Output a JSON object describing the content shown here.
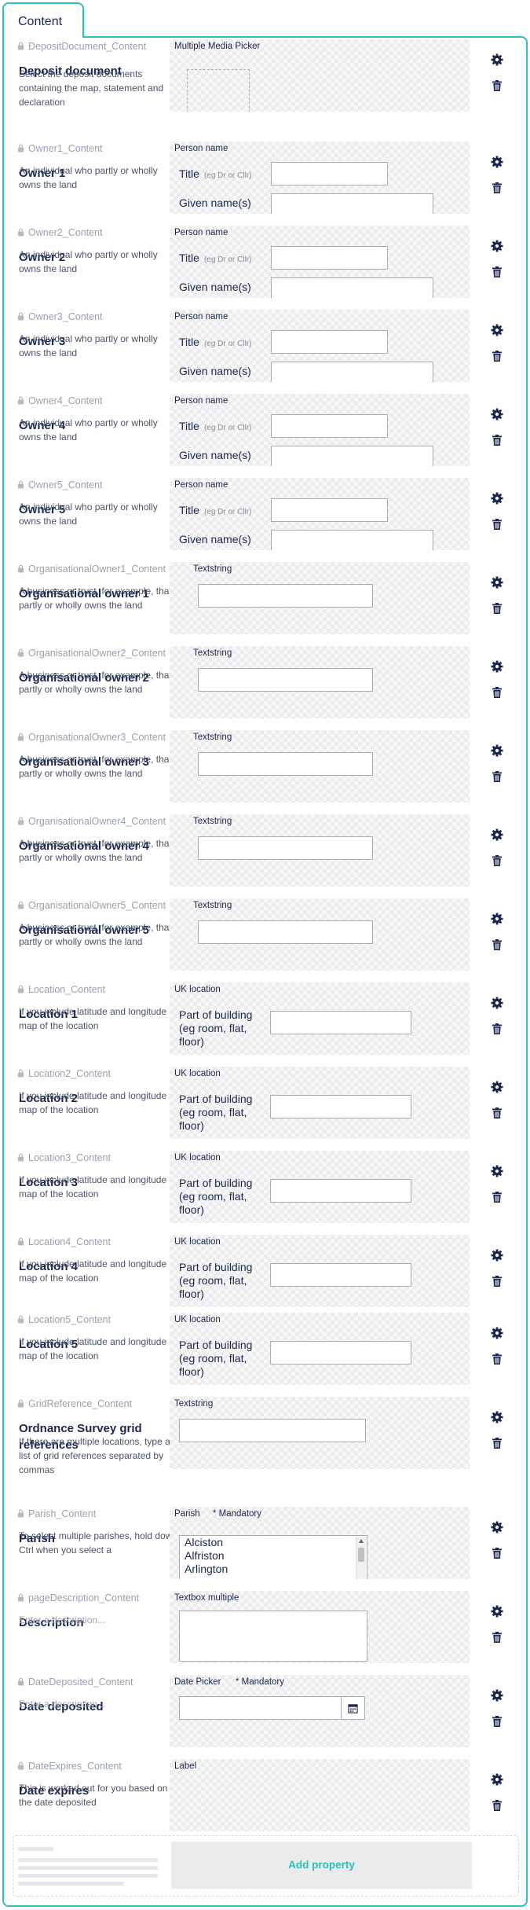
{
  "tab": {
    "label": "Content"
  },
  "properties": [
    {
      "alias": "DepositDocument_Content",
      "label": "Deposit document",
      "description": "Select the deposit documents containing the map, statement and declaration",
      "editor": "Multiple Media Picker"
    },
    {
      "alias": "Owner1_Content",
      "label": "Owner 1",
      "description": "An individual who partly or wholly owns the land",
      "editor": "Person name"
    },
    {
      "alias": "Owner2_Content",
      "label": "Owner 2",
      "description": "An individual who partly or wholly owns the land",
      "editor": "Person name"
    },
    {
      "alias": "Owner3_Content",
      "label": "Owner 3",
      "description": "An individual who partly or wholly owns the land",
      "editor": "Person name"
    },
    {
      "alias": "Owner4_Content",
      "label": "Owner 4",
      "description": "An individual who partly or wholly owns the land",
      "editor": "Person name"
    },
    {
      "alias": "Owner5_Content",
      "label": "Owner 5",
      "description": "An individual who partly or wholly owns the land",
      "editor": "Person name"
    },
    {
      "alias": "OrganisationalOwner1_Content",
      "label": "Organisational owner 1",
      "description": "A business or trust, for example, that partly or wholly owns the land",
      "editor": "Textstring"
    },
    {
      "alias": "OrganisationalOwner2_Content",
      "label": "Organisational owner 2",
      "description": "A business or trust, for example, that partly or wholly owns the land",
      "editor": "Textstring"
    },
    {
      "alias": "OrganisationalOwner3_Content",
      "label": "Organisational owner 3",
      "description": "A business or trust, for example, that partly or wholly owns the land",
      "editor": "Textstring"
    },
    {
      "alias": "OrganisationalOwner4_Content",
      "label": "Organisational owner 4",
      "description": "A business or trust, for example, that partly or wholly owns the land",
      "editor": "Textstring"
    },
    {
      "alias": "OrganisationalOwner5_Content",
      "label": "Organisational owner 5",
      "description": "A business or trust, for example, that partly or wholly owns the land",
      "editor": "Textstring"
    },
    {
      "alias": "Location_Content",
      "label": "Location 1",
      "description": "If you include latitude and longitude a map of the location",
      "editor": "UK location"
    },
    {
      "alias": "Location2_Content",
      "label": "Location 2",
      "description": "If you include latitude and longitude a map of the location",
      "editor": "UK location"
    },
    {
      "alias": "Location3_Content",
      "label": "Location 3",
      "description": "If you include latitude and longitude a map of the location",
      "editor": "UK location"
    },
    {
      "alias": "Location4_Content",
      "label": "Location 4",
      "description": "If you include latitude and longitude a map of the location",
      "editor": "UK location"
    },
    {
      "alias": "Location5_Content",
      "label": "Location 5",
      "description": "If you include latitude and longitude a map of the location",
      "editor": "UK location"
    },
    {
      "alias": "GridReference_Content",
      "label": "Ordnance Survey grid references",
      "description": "If there are multiple locations, type a list of grid references separated by commas",
      "editor": "Textstring"
    },
    {
      "alias": "Parish_Content",
      "label": "Parish",
      "description": "To select multiple parishes, hold down Ctrl when you select a",
      "editor": "Parish",
      "mandatory": "* Mandatory"
    },
    {
      "alias": "pageDescription_Content",
      "label": "Description",
      "description": "Enter a description...",
      "editor": "Textbox multiple"
    },
    {
      "alias": "DateDeposited_Content",
      "label": "Date deposited",
      "description": "Enter a description...",
      "editor": "Date Picker",
      "mandatory": "* Mandatory"
    },
    {
      "alias": "DateExpires_Content",
      "label": "Date expires",
      "description": "This is worked out for you based on the date deposited",
      "editor": "Label"
    }
  ],
  "person_name": {
    "title_label": "Title",
    "title_hint": "(eg Dr or Cllr)",
    "given_label": "Given name(s)"
  },
  "uk_location": {
    "part_of_building_label": "Part of building (eg room, flat, floor)"
  },
  "parish": {
    "options": [
      "Alciston",
      "Alfriston",
      "Arlington"
    ]
  },
  "add_property": {
    "label": "Add property"
  },
  "colors": {
    "accent": "#2bc0b9",
    "text": "#1b264f",
    "alias": "#98a0ae"
  },
  "icons": {
    "settings": "gear-icon",
    "delete": "trash-icon",
    "lock": "lock-icon",
    "calendar": "calendar-icon"
  }
}
